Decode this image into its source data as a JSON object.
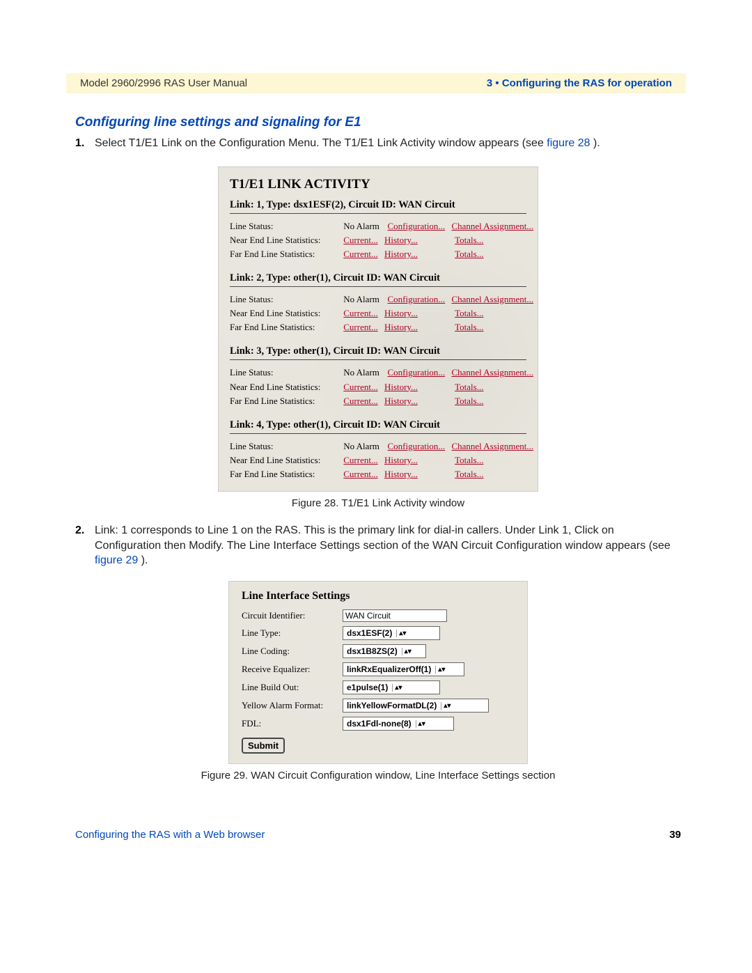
{
  "header": {
    "left": "Model 2960/2996 RAS User Manual",
    "right": "3 • Configuring the RAS for operation"
  },
  "heading": "Configuring line settings and signaling for E1",
  "step1": {
    "num": "1.",
    "f1": "Select ",
    "f2": "T1/E1 Link ",
    "f3": "on the ",
    "f4": "Configuration Menu. ",
    "f5": "The T1/E1 Link Activity window appears (see ",
    "fig": "figure 28",
    "f6": ")."
  },
  "screenshot1": {
    "title": "T1/E1 LINK ACTIVITY",
    "labels": {
      "lineStatus": "Line Status:",
      "noAlarm": "No Alarm",
      "configuration": "Configuration...",
      "channelAssignment": "Channel Assignment...",
      "nearEnd": "Near End Line Statistics:",
      "farEnd": "Far End Line Statistics:",
      "current": "Current...",
      "history": "History...",
      "totals": "Totals..."
    },
    "links": [
      {
        "heading": "Link: 1, Type: dsx1ESF(2), Circuit ID: WAN Circuit"
      },
      {
        "heading": "Link: 2, Type: other(1), Circuit ID: WAN Circuit"
      },
      {
        "heading": "Link: 3, Type: other(1), Circuit ID: WAN Circuit"
      },
      {
        "heading": "Link: 4, Type: other(1), Circuit ID: WAN Circuit"
      }
    ]
  },
  "caption1": "Figure 28. T1/E1 Link Activity window",
  "step2": {
    "num": "2.",
    "f1": "Link: 1 corresponds to Line 1 on the RAS. This is the primary link for dial-in callers. Under Link 1, Click on ",
    "f2": "Configuration ",
    "f3": "then ",
    "f4": "Modify. ",
    "f5": "The Line Interface Settings section of the WAN Circuit Configuration window appears (see ",
    "fig": "figure 29",
    "f6": ")."
  },
  "screenshot2": {
    "title": "Line Interface Settings",
    "rows": {
      "circuitId": {
        "label": "Circuit Identifier:",
        "value": "WAN Circuit"
      },
      "lineType": {
        "label": "Line Type:",
        "value": "dsx1ESF(2)"
      },
      "lineCoding": {
        "label": "Line Coding:",
        "value": "dsx1B8ZS(2)"
      },
      "rxEq": {
        "label": "Receive Equalizer:",
        "value": "linkRxEqualizerOff(1)"
      },
      "lbo": {
        "label": "Line Build Out:",
        "value": "e1pulse(1)"
      },
      "yellow": {
        "label": "Yellow Alarm Format:",
        "value": "linkYellowFormatDL(2)"
      },
      "fdl": {
        "label": "FDL:",
        "value": "dsx1Fdl-none(8)"
      }
    },
    "submit": "Submit"
  },
  "caption2": "Figure 29. WAN Circuit Configuration window, Line Interface Settings section",
  "footer": {
    "left": "Configuring the RAS with a Web browser",
    "right": "39"
  },
  "glyphs": {
    "updown": "▴▾"
  }
}
